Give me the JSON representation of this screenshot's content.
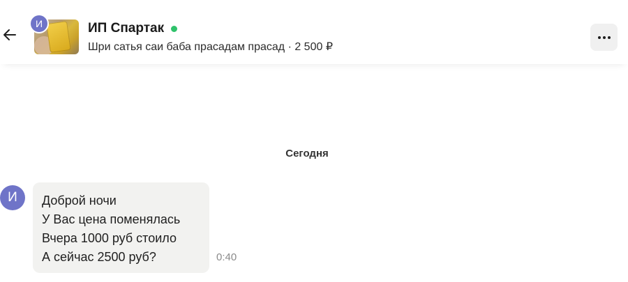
{
  "header": {
    "back_icon": "arrow-left-icon",
    "avatar_initial": "И",
    "title": "ИП Спартак",
    "online_color": "#2fc26b",
    "subtitle": "Шри сатья саи баба прасадам прасад · 2 500 ₽",
    "menu_icon": "more-horizontal-icon"
  },
  "chat": {
    "date_separator": "Сегодня",
    "messages": [
      {
        "avatar_initial": "И",
        "lines": [
          "Доброй ночи",
          "У Вас цена поменялась",
          "Вчера 1000 руб стоило",
          "А сейчас 2500 руб?"
        ],
        "time": "0:40"
      }
    ]
  },
  "colors": {
    "avatar": "#6f74c8",
    "bubble": "#f2f2f0",
    "menu_bg": "#f0f0f0"
  }
}
